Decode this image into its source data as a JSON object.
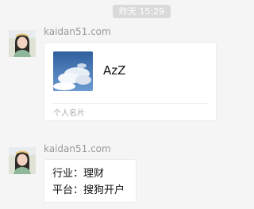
{
  "timestamp": "昨天 15:29",
  "messages": [
    {
      "sender": "kaidan51.com",
      "avatar_icon": "girl-avatar",
      "card": {
        "name": "AzZ",
        "thumbnail_icon": "sky-clouds-photo",
        "type_label": "个人名片"
      }
    },
    {
      "sender": "kaidan51.com",
      "avatar_icon": "girl-avatar",
      "text_lines": [
        "行业：理财",
        "平台：搜狗开户"
      ]
    }
  ]
}
